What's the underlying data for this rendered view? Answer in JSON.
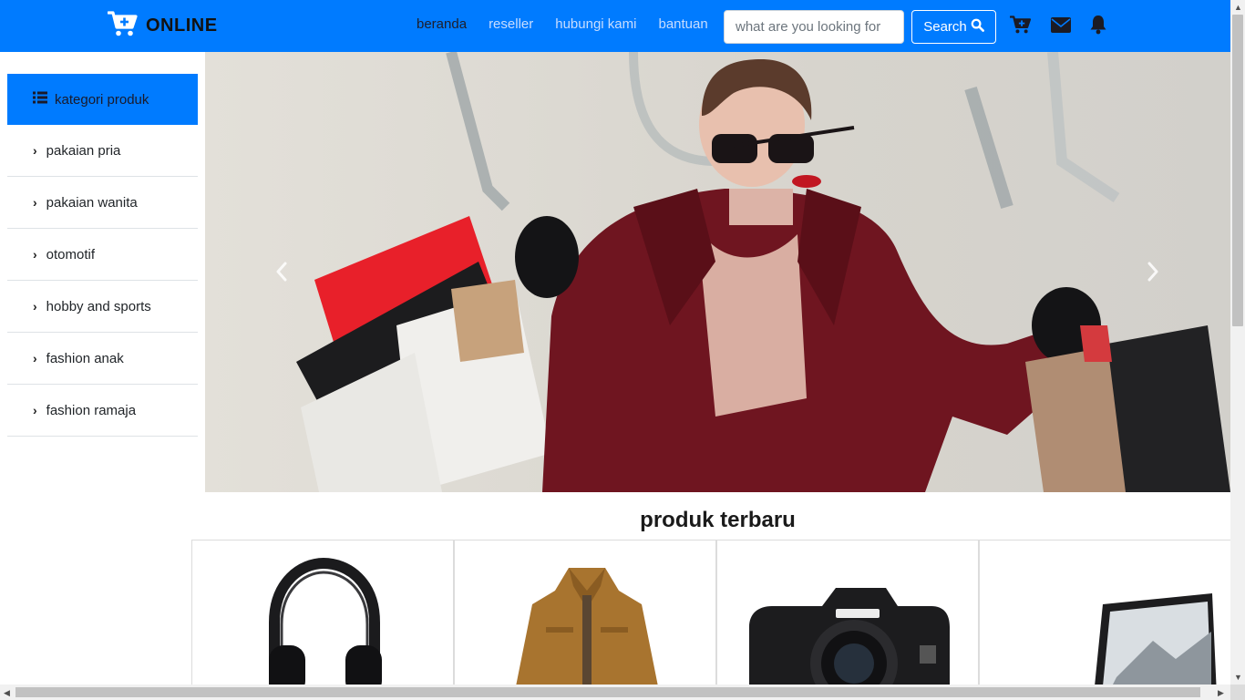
{
  "brand": {
    "name": "ONLINE",
    "icon": "cart-plus-icon"
  },
  "nav": {
    "links": [
      {
        "label": "beranda",
        "active": true
      },
      {
        "label": "reseller",
        "active": false
      },
      {
        "label": "hubungi kami",
        "active": false
      },
      {
        "label": "bantuan",
        "active": false
      }
    ]
  },
  "search": {
    "placeholder": "what are you looking for",
    "button_label": "Search",
    "icon": "search-icon"
  },
  "header_icons": [
    "cart-plus-icon",
    "envelope-icon",
    "bell-icon"
  ],
  "sidebar": {
    "heading": "kategori produk",
    "heading_icon": "list-icon",
    "items": [
      {
        "label": "pakaian pria"
      },
      {
        "label": "pakaian wanita"
      },
      {
        "label": "otomotif"
      },
      {
        "label": "hobby and sports"
      },
      {
        "label": "fashion anak"
      },
      {
        "label": "fashion ramaja"
      }
    ]
  },
  "carousel": {
    "prev_icon": "chevron-left-icon",
    "next_icon": "chevron-right-icon"
  },
  "products_section": {
    "title": "produk terbaru",
    "items": [
      {
        "image": "headphones"
      },
      {
        "image": "jacket"
      },
      {
        "image": "camera"
      },
      {
        "image": "laptop"
      }
    ]
  },
  "colors": {
    "primary": "#007bff",
    "border": "#dee2e6"
  }
}
